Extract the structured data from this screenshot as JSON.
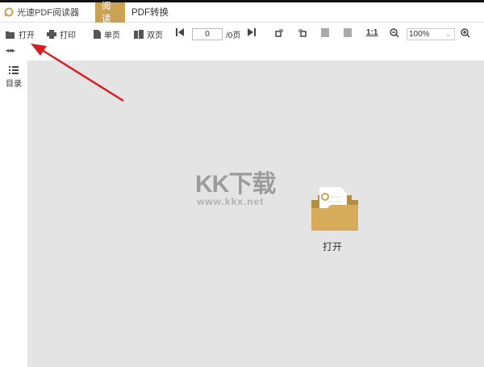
{
  "app": {
    "title": "光速PDF阅读器"
  },
  "tabs": [
    {
      "label": "阅读",
      "active": true
    },
    {
      "label": "PDF转换",
      "active": false
    }
  ],
  "toolbar": {
    "open": "打开",
    "print": "打印",
    "single_page": "单页",
    "double_page": "双页",
    "page_value": "0",
    "page_total": "/0页",
    "actual_size": "1:1",
    "zoom": "100%"
  },
  "sidebar": {
    "toc": "目录"
  },
  "main": {
    "open_label": "打开",
    "watermark": "KK下载",
    "watermark_url": "www.kkx.net"
  },
  "colors": {
    "accent": "#c9a256",
    "canvas": "#e4e4e4",
    "arrow": "#d42020"
  }
}
